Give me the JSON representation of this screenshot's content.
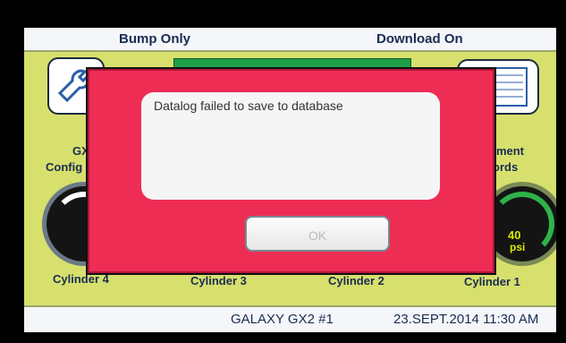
{
  "top_bar": {
    "left": "Bump Only",
    "right": "Download On"
  },
  "tiles": {
    "gx2_config": {
      "line1": "GX",
      "line2": "Config",
      "icon": "wrench-icon"
    },
    "instrument_records": {
      "line1": "ument",
      "line2": "ords",
      "icon": "records-icon"
    }
  },
  "cylinders": {
    "c4": "Cylinder 4",
    "c3": "Cylinder 3",
    "c2": "Cylinder 2",
    "c1": "Cylinder 1",
    "c1_value": "40",
    "c1_unit": "psi"
  },
  "dialog": {
    "message": "Datalog failed to save to database",
    "ok_label": "OK"
  },
  "bottom_bar": {
    "device": "GALAXY GX2 #1",
    "datetime": "23.SEPT.2014 11:30 AM"
  },
  "colors": {
    "screen": "#d7e06d",
    "dialog": "#ee2d55",
    "text": "#1a2c52"
  }
}
